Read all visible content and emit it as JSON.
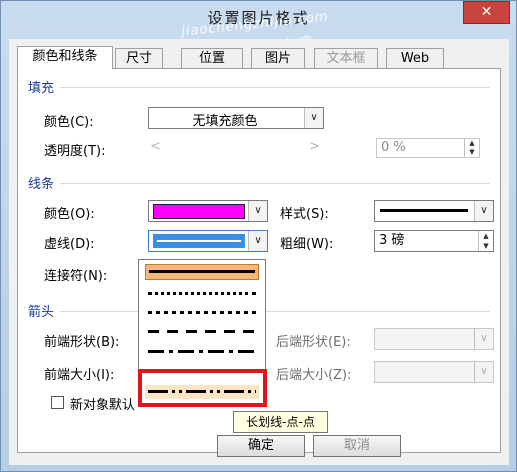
{
  "window": {
    "title": "设置图片格式",
    "watermark_url": "jiaochengzhijia.com",
    "watermark_cn": "教程之家",
    "close_glyph": "✕"
  },
  "tabs": [
    {
      "label": "颜色和线条",
      "active": true,
      "disabled": false
    },
    {
      "label": "尺寸",
      "active": false,
      "disabled": false
    },
    {
      "label": "位置",
      "active": false,
      "disabled": false
    },
    {
      "label": "图片",
      "active": false,
      "disabled": false
    },
    {
      "label": "文本框",
      "active": false,
      "disabled": true
    },
    {
      "label": "Web",
      "active": false,
      "disabled": false
    }
  ],
  "fill": {
    "section_label": "填充",
    "color_label": "颜色(C):",
    "color_value": "无填充颜色",
    "transparency_label": "透明度(T):",
    "transparency_value": "0 %",
    "slider_left_glyph": "<",
    "slider_right_glyph": ">"
  },
  "line": {
    "section_label": "线条",
    "color_label": "颜色(O):",
    "color_swatch": "#ff00ff",
    "style_label": "样式(S):",
    "dash_label": "虚线(D):",
    "weight_label": "粗细(W):",
    "weight_value": "3 磅",
    "connector_label": "连接符(N):"
  },
  "arrows": {
    "section_label": "箭头",
    "begin_style_label": "前端形状(B):",
    "begin_size_label": "前端大小(I):",
    "end_style_label": "后端形状(E):",
    "end_size_label": "后端大小(Z):"
  },
  "default_checkbox_label": "新对象默认",
  "dash_options": [
    {
      "name": "solid"
    },
    {
      "name": "round-dot"
    },
    {
      "name": "square-dot"
    },
    {
      "name": "dash"
    },
    {
      "name": "dash-dot"
    },
    {
      "name": "long-dash"
    },
    {
      "name": "long-dash-dot-dot"
    }
  ],
  "tooltip": "长划线-点-点",
  "buttons": {
    "ok": "确定",
    "cancel": "取消"
  },
  "arrow_glyph": "∨",
  "colors": {
    "highlight": "#e0151b",
    "title_bg": "#c9dcef",
    "section": "#1a3a9a",
    "accent_line": "#1c7fe0",
    "selected_option": "#f6b779"
  }
}
